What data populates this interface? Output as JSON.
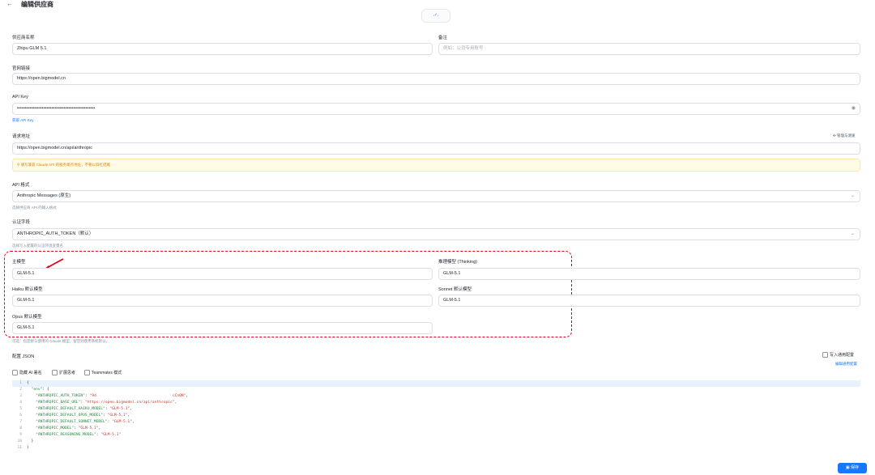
{
  "header": {
    "back_icon": "←",
    "title": "编辑供应商",
    "logo_icon": "zhipu-logo-icon",
    "logo_glyph": "ᐧᐟᐧ"
  },
  "fields": {
    "provider_name": {
      "label": "供应商名称",
      "value": "Zhipu GLM 5.1"
    },
    "remark": {
      "label": "备注",
      "placeholder": "例如：公司专用账号"
    },
    "website": {
      "label": "官网链接",
      "value": "https://open.bigmodel.cn"
    },
    "api_key": {
      "label": "API Key",
      "value": "••••••••••••••••••••••••••••••••••••••••••••••••••",
      "get_link": "获取 API Key",
      "eye_icon": "◉"
    },
    "request_url": {
      "label": "请求地址",
      "value": "https://open.bigmodel.cn/api/anthropic",
      "manage_link": "管理与测速",
      "manage_icon": "✣"
    },
    "warning": {
      "icon": "⚲",
      "text": "填写兼容 Claude API 的服务端点地址，不要以斜杠结尾"
    },
    "api_format": {
      "label": "API 格式",
      "value": "Anthropic Messages (原生)",
      "hint": "选择供应商 API 的输入格式"
    },
    "auth_field": {
      "label": "认证字段",
      "value": "ANTHROPIC_AUTH_TOKEN（默认）",
      "hint": "选择写入配置的认证环境变量名"
    }
  },
  "models": {
    "main": {
      "label": "主模型",
      "value": "GLM-5.1"
    },
    "reasoning": {
      "label": "推理模型 (Thinking)",
      "value": "GLM-5.1"
    },
    "haiku": {
      "label": "Haiku 默认模型",
      "value": "GLM-5.1"
    },
    "sonnet": {
      "label": "Sonnet 默认模型",
      "value": "GLM-5.1"
    },
    "opus": {
      "label": "Opus 默认模型",
      "value": "GLM-5.1"
    },
    "hint": "可选：指定默认使用的 Claude 模型，留空则使用系统默认。"
  },
  "config": {
    "label": "配置 JSON",
    "write_common": "写入通用配置",
    "edit_common": "编辑通用配置",
    "options": [
      "隐藏 AI 署名",
      "扩展思考",
      "Teammates 模式"
    ],
    "lines": [
      {
        "n": "1",
        "text": "{"
      },
      {
        "n": "2",
        "key": "\"env\"",
        "rest": ": {"
      },
      {
        "n": "3",
        "key": "\"ANTHROPIC_AUTH_TOKEN\"",
        "val": "\"9d                                  cCn0N\"",
        "tail": ","
      },
      {
        "n": "4",
        "key": "\"ANTHROPIC_BASE_URL\"",
        "val": "\"https://open.bigmodel.cn/api/anthropic\"",
        "tail": ","
      },
      {
        "n": "5",
        "key": "\"ANTHROPIC_DEFAULT_HAIKU_MODEL\"",
        "val": "\"GLM-5.1\"",
        "tail": ","
      },
      {
        "n": "6",
        "key": "\"ANTHROPIC_DEFAULT_OPUS_MODEL\"",
        "val": "\"GLM-5.1\"",
        "tail": ","
      },
      {
        "n": "7",
        "key": "\"ANTHROPIC_DEFAULT_SONNET_MODEL\"",
        "val": "\"GLM-5.1\"",
        "tail": ","
      },
      {
        "n": "8",
        "key": "\"ANTHROPIC_MODEL\"",
        "val": "\"GLM-5.1\"",
        "tail": ","
      },
      {
        "n": "9",
        "key": "\"ANTHROPIC_REASONING_MODEL\"",
        "val": "\"GLM-5.1\"",
        "tail": ""
      },
      {
        "n": "10",
        "text": "  }"
      },
      {
        "n": "11",
        "text": "}"
      }
    ]
  },
  "save": {
    "label": "保存",
    "icon": "▣"
  },
  "colors": {
    "accent": "#1677ff",
    "annotation": "#e60012",
    "warning_bg": "#fffbe6"
  }
}
